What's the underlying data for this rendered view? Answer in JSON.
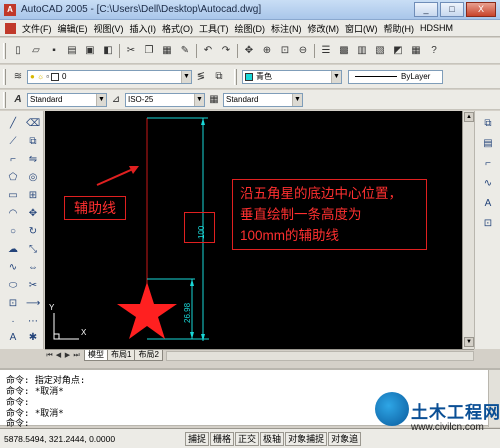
{
  "window": {
    "title": "AutoCAD 2005 - [C:\\Users\\Dell\\Desktop\\Autocad.dwg]",
    "minimize": "_",
    "maximize": "□",
    "close": "X"
  },
  "menu": [
    "文件(F)",
    "编辑(E)",
    "视图(V)",
    "插入(I)",
    "格式(O)",
    "工具(T)",
    "绘图(D)",
    "标注(N)",
    "修改(M)",
    "窗口(W)",
    "帮助(H)",
    "HDSHM"
  ],
  "layers": {
    "layer_value": "0",
    "color_value": "青色",
    "linetype_value": "ByLayer"
  },
  "styles": {
    "text_style": "Standard",
    "dim_style": "ISO-25",
    "table_style": "Standard"
  },
  "drawing": {
    "callout_short": "辅助线",
    "callout_long": [
      "沿五角星的底边中心位置，",
      "垂直绘制一条高度为",
      "100mm的辅助线"
    ],
    "dim_100": "100",
    "dim_2698": "26.98",
    "ucs_x": "X",
    "ucs_y": "Y",
    "colors": {
      "cyan": "#19d8d8",
      "red": "#ff2020",
      "red_line": "#c81818",
      "white": "#ffffff"
    }
  },
  "tabs": {
    "model": "模型",
    "layout1": "布局1",
    "layout2": "布局2"
  },
  "command": {
    "lines": [
      "命令: 指定对角点:",
      "命令: *取消*",
      "命令:",
      "命令: *取消*",
      "命令:"
    ]
  },
  "status": {
    "coords": "5878.5494, 321.2444, 0.0000",
    "buttons": [
      "捕捉",
      "栅格",
      "正交",
      "极轴",
      "对象捕捉",
      "对象追"
    ]
  },
  "watermark": {
    "text": "土木工程网",
    "url": "www.civilcn.com"
  }
}
